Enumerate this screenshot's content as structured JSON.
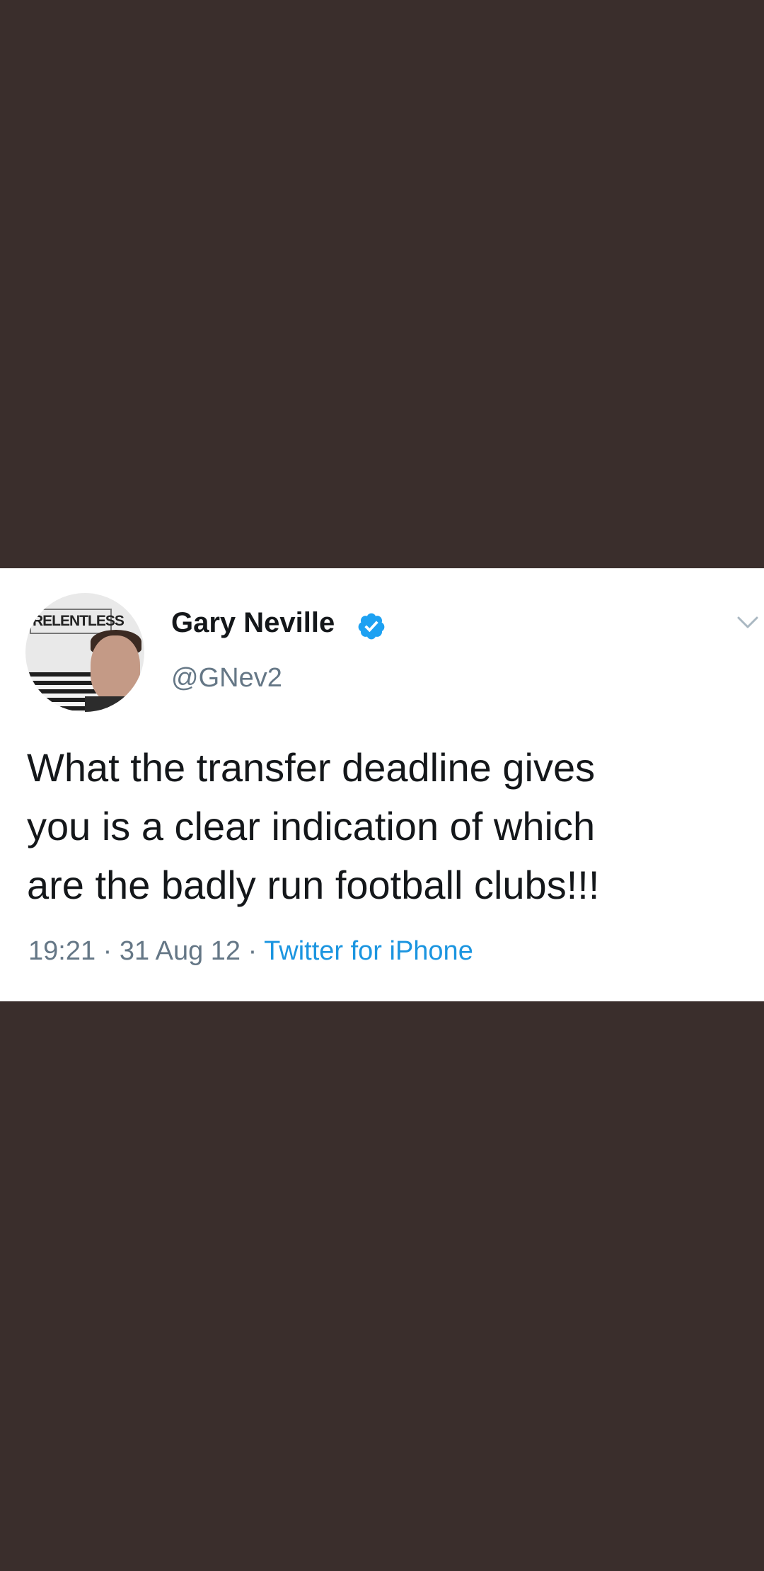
{
  "tweet": {
    "display_name": "Gary Neville",
    "handle": "@GNev2",
    "verified": true,
    "avatar": {
      "poster_text": "RELENTLESS"
    },
    "text_lines": [
      "What the transfer deadline gives",
      "you is a clear indication of which",
      "are the badly run football clubs!!!"
    ],
    "time": "19:21",
    "separator": "·",
    "date": "31 Aug 12",
    "source": "Twitter for iPhone"
  },
  "icons": {
    "verified": "verified-badge-icon",
    "menu": "chevron-down-icon"
  },
  "colors": {
    "background": "#3a2e2c",
    "card": "#ffffff",
    "text": "#14171a",
    "muted": "#657786",
    "link": "#1b95e0",
    "verified": "#1da1f2"
  }
}
